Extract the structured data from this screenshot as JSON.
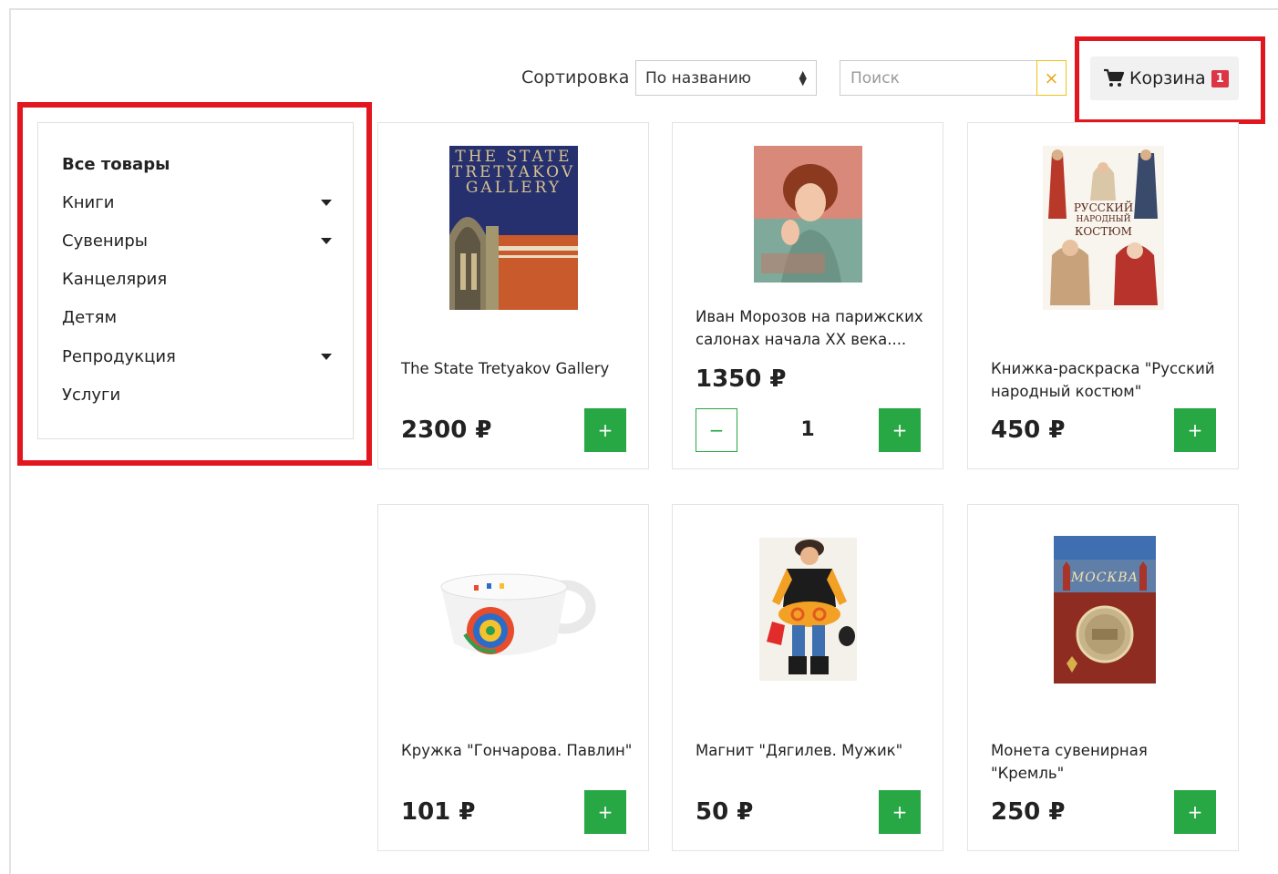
{
  "toolbar": {
    "sort_label": "Сортировка",
    "sort_value": "По названию",
    "search_placeholder": "Поиск",
    "clear_icon": "×",
    "cart_label": "Корзина",
    "cart_count": "1"
  },
  "sidebar": {
    "items": [
      {
        "label": "Все товары",
        "bold": true,
        "has_submenu": false
      },
      {
        "label": "Книги",
        "has_submenu": true
      },
      {
        "label": "Сувениры",
        "has_submenu": true
      },
      {
        "label": "Канцелярия",
        "has_submenu": false
      },
      {
        "label": "Детям",
        "has_submenu": false
      },
      {
        "label": "Репродукция",
        "has_submenu": true
      },
      {
        "label": "Услуги",
        "has_submenu": false
      }
    ]
  },
  "products": [
    {
      "title": "The State Tretyakov Gallery",
      "price": "2300 ₽",
      "add_label": "+",
      "image_text": [
        "THE STATE",
        "TRETYAKOV",
        "GALLERY"
      ]
    },
    {
      "title": "Иван Морозов на парижских салонах начала XX века....",
      "price": "1350 ₽",
      "add_label": "+",
      "minus_label": "−",
      "quantity": "1"
    },
    {
      "title": "Книжка-раскраска \"Русский народный костюм\"",
      "price": "450 ₽",
      "add_label": "+",
      "image_text": [
        "РУССКИЙ",
        "НАРОДНЫЙ",
        "КОСТЮМ"
      ]
    },
    {
      "title": "Кружка \"Гончарова. Павлин\"",
      "price": "101 ₽",
      "add_label": "+"
    },
    {
      "title": "Магнит \"Дягилев. Мужик\"",
      "price": "50 ₽",
      "add_label": "+"
    },
    {
      "title": "Монета сувенирная \"Кремль\"",
      "price": "250 ₽",
      "add_label": "+",
      "image_text": [
        "МОСКВА"
      ]
    }
  ],
  "colors": {
    "accent_green": "#28a745",
    "highlight_red": "#e2161e",
    "badge_red": "#dc3545"
  }
}
